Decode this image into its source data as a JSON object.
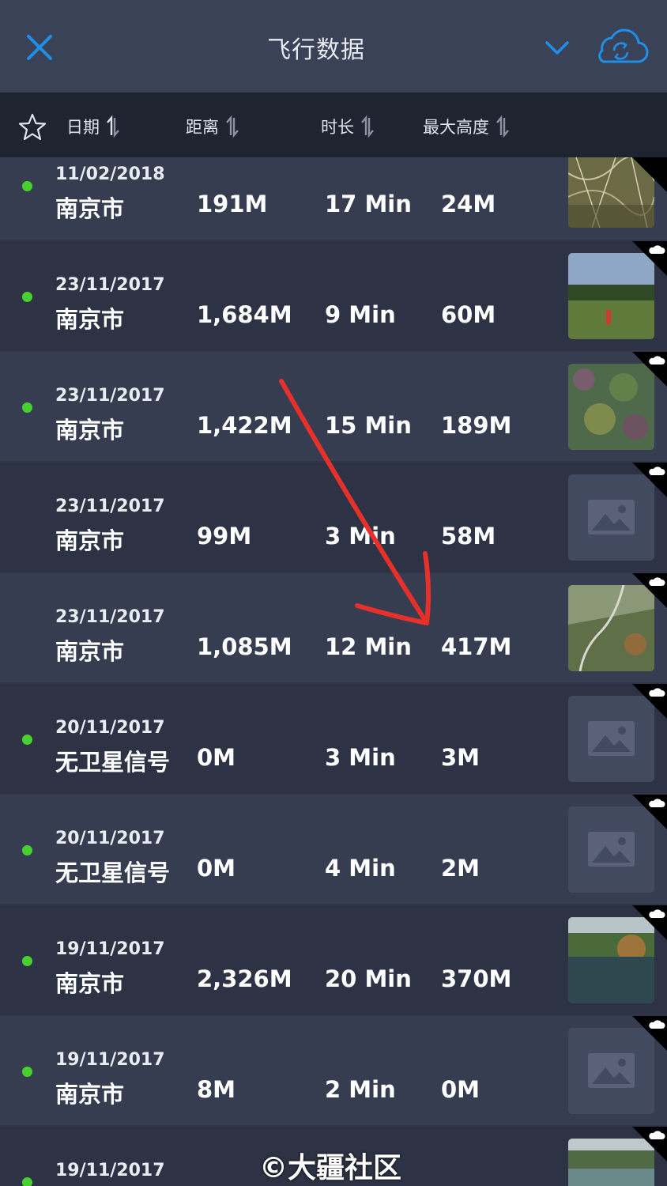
{
  "header": {
    "title": "飞行数据"
  },
  "columns": {
    "date": "日期",
    "distance": "距离",
    "duration": "时长",
    "max_altitude": "最大高度"
  },
  "colors": {
    "accent": "#1f8fe8",
    "dot": "#48d12e",
    "arrow": "#e8302b"
  },
  "rows": [
    {
      "date": "11/02/2018",
      "city": "南京市",
      "distance": "191M",
      "duration": "17 Min",
      "altitude": "24M",
      "thumb": "photo-bushes",
      "dot": true,
      "cloud": false
    },
    {
      "date": "23/11/2017",
      "city": "南京市",
      "distance": "1,684M",
      "duration": "9 Min",
      "altitude": "60M",
      "thumb": "photo-field",
      "dot": true,
      "cloud": true
    },
    {
      "date": "23/11/2017",
      "city": "南京市",
      "distance": "1,422M",
      "duration": "15 Min",
      "altitude": "189M",
      "thumb": "photo-aerial-colorful",
      "dot": true,
      "cloud": true
    },
    {
      "date": "23/11/2017",
      "city": "南京市",
      "distance": "99M",
      "duration": "3 Min",
      "altitude": "58M",
      "thumb": "placeholder",
      "dot": false,
      "cloud": true
    },
    {
      "date": "23/11/2017",
      "city": "南京市",
      "distance": "1,085M",
      "duration": "12 Min",
      "altitude": "417M",
      "thumb": "photo-hill-road",
      "dot": false,
      "cloud": true
    },
    {
      "date": "20/11/2017",
      "city": "无卫星信号",
      "distance": "0M",
      "duration": "3 Min",
      "altitude": "3M",
      "thumb": "placeholder",
      "dot": true,
      "cloud": true
    },
    {
      "date": "20/11/2017",
      "city": "无卫星信号",
      "distance": "0M",
      "duration": "4 Min",
      "altitude": "2M",
      "thumb": "placeholder",
      "dot": true,
      "cloud": true
    },
    {
      "date": "19/11/2017",
      "city": "南京市",
      "distance": "2,326M",
      "duration": "20 Min",
      "altitude": "370M",
      "thumb": "photo-lake",
      "dot": true,
      "cloud": true
    },
    {
      "date": "19/11/2017",
      "city": "南京市",
      "distance": "8M",
      "duration": "2 Min",
      "altitude": "0M",
      "thumb": "placeholder",
      "dot": true,
      "cloud": true
    },
    {
      "date": "19/11/2017",
      "city": "",
      "distance": "",
      "duration": "",
      "altitude": "",
      "thumb": "photo-lake2",
      "dot": true,
      "cloud": true
    }
  ],
  "watermark": "©大疆社区"
}
